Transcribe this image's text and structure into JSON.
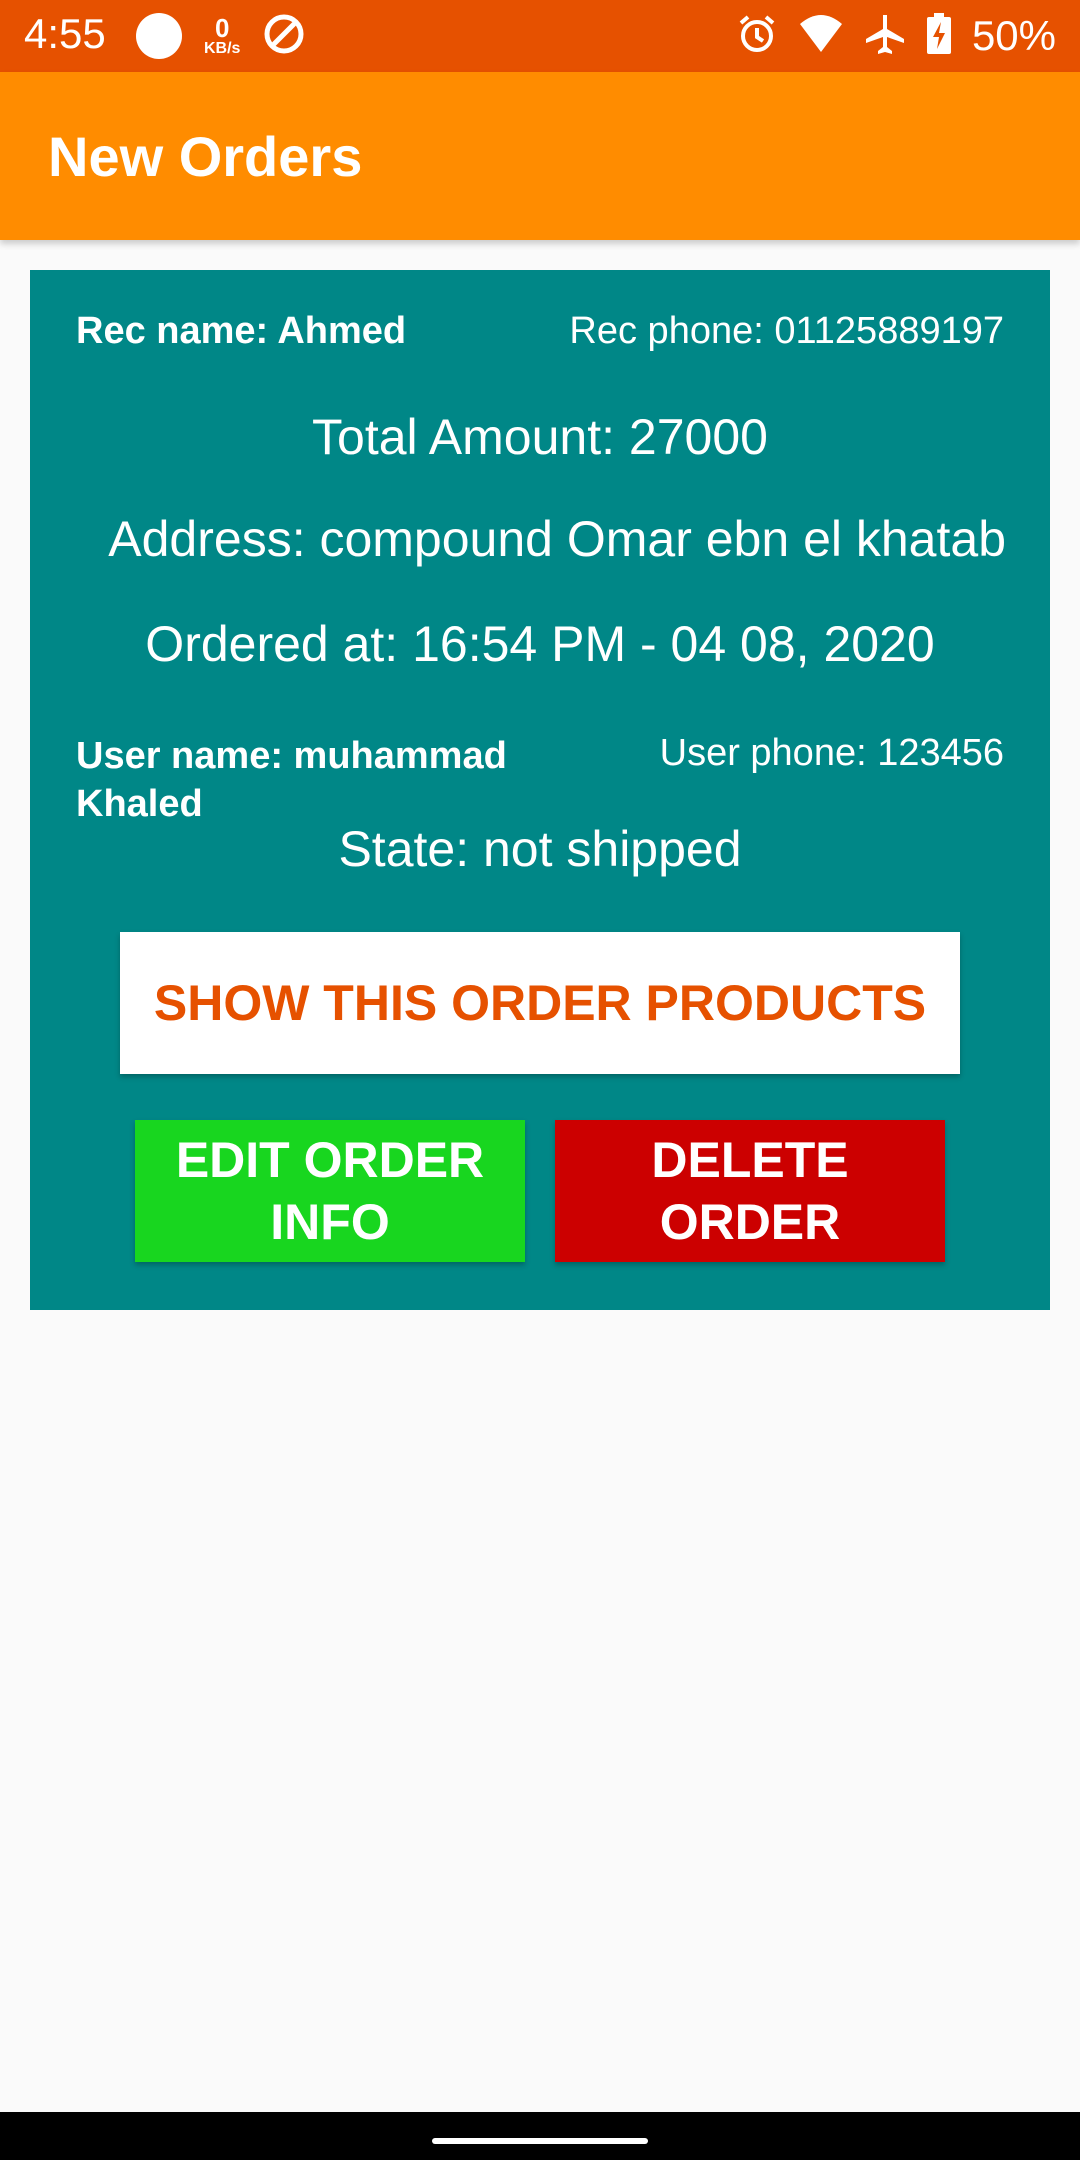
{
  "status_bar": {
    "time": "4:55",
    "net_speed_value": "0",
    "net_speed_unit": "KB/s",
    "battery": "50%",
    "icons": [
      "app-notification-icon",
      "data-usage-icon",
      "alarm-icon",
      "wifi-icon",
      "airplane-mode-icon",
      "battery-charging-icon"
    ]
  },
  "app_bar": {
    "title": "New Orders",
    "color": "#ff8c00"
  },
  "order": {
    "rec_name": "Rec name: Ahmed",
    "rec_phone": "Rec phone: 01125889197",
    "total_amount": "Total Amount: 27000",
    "address": "Address: compound Omar ebn el khatab",
    "ordered_at": "Ordered at: 16:54 PM - 04 08, 2020",
    "user_name": "User name: muhammad Khaled",
    "user_phone": "User phone: 123456",
    "state": "State: not shipped",
    "card_color": "#008787"
  },
  "actions": {
    "show_products": "SHOW THIS ORDER PRODUCTS",
    "edit_order": "EDIT ORDER INFO",
    "delete_order": "DELETE ORDER",
    "colors": {
      "show": "#ffffff",
      "edit": "#18d61f",
      "delete": "#cc0000"
    }
  }
}
